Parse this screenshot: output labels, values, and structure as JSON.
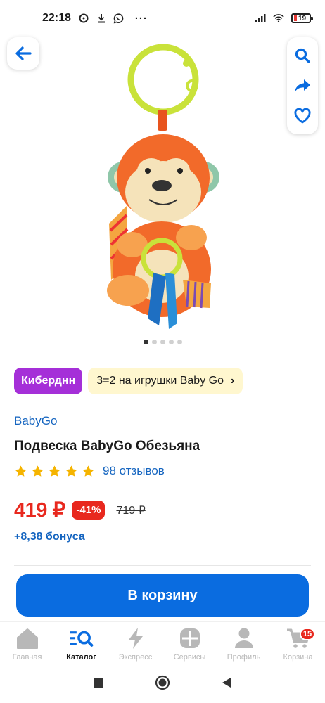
{
  "status_bar": {
    "time": "22:18",
    "battery": "19",
    "more": "···"
  },
  "colors": {
    "primary": "#0a6ce0",
    "price": "#e8281e",
    "promo_tag": "#a52fd8",
    "promo_offer_bg": "#fff7cf",
    "link": "#1565c0",
    "star": "#f5b400"
  },
  "toolbar": {
    "back_icon": "arrow-left-icon",
    "tools": [
      "search-icon",
      "share-icon",
      "heart-icon"
    ]
  },
  "gallery": {
    "image": "monkey-toy-pendant",
    "count": 5,
    "active_index": 0
  },
  "promo": {
    "tag": "Киберднн",
    "offer": "3=2 на игрушки Baby Go",
    "chevron": "›"
  },
  "product": {
    "brand": "BabyGo",
    "title": "Подвеска BabyGo Обезьяна",
    "rating": 5,
    "reviews": "98 отзывов",
    "price": "419 ₽",
    "discount": "-41%",
    "old_price": "719 ₽",
    "bonus": "+8,38 бонуса"
  },
  "cart_button": {
    "label": "В корзину"
  },
  "bottom_nav": {
    "items": [
      {
        "label": "Главная",
        "icon": "home-icon"
      },
      {
        "label": "Каталог",
        "icon": "catalog-search-icon"
      },
      {
        "label": "Экспресс",
        "icon": "lightning-icon"
      },
      {
        "label": "Сервисы",
        "icon": "services-icon"
      },
      {
        "label": "Профиль",
        "icon": "profile-icon"
      },
      {
        "label": "Корзина",
        "icon": "cart-icon",
        "badge": "15"
      }
    ],
    "active": "Каталог"
  },
  "system_nav": [
    "recents-icon",
    "home-circle-icon",
    "back-triangle-icon"
  ]
}
